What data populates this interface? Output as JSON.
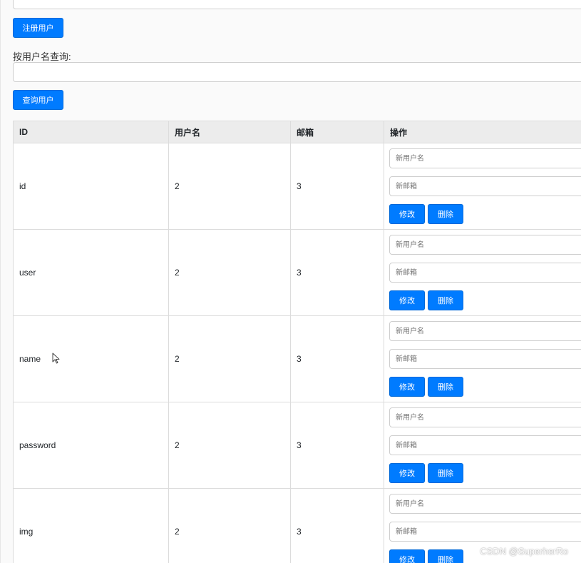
{
  "form": {
    "register_button": "注册用户",
    "query_label": "按用户名查询:",
    "query_button": "查询用户"
  },
  "table": {
    "columns": [
      "ID",
      "用户名",
      "邮箱",
      "操作"
    ],
    "rows": [
      {
        "id": "id",
        "username": "2",
        "email": "3"
      },
      {
        "id": "user",
        "username": "2",
        "email": "3"
      },
      {
        "id": "name",
        "username": "2",
        "email": "3"
      },
      {
        "id": "password",
        "username": "2",
        "email": "3"
      },
      {
        "id": "img",
        "username": "2",
        "email": "3"
      }
    ],
    "actions": {
      "new_username_placeholder": "新用户名",
      "new_email_placeholder": "新邮箱",
      "edit_label": "修改",
      "delete_label": "删除"
    }
  },
  "watermark": "CSDN @SuperherRo",
  "theme": {
    "primary": "#007bff",
    "header_bg": "#ececec",
    "border": "#dcdcdc"
  },
  "icons": {
    "cursor": "mouse-pointer-icon"
  }
}
